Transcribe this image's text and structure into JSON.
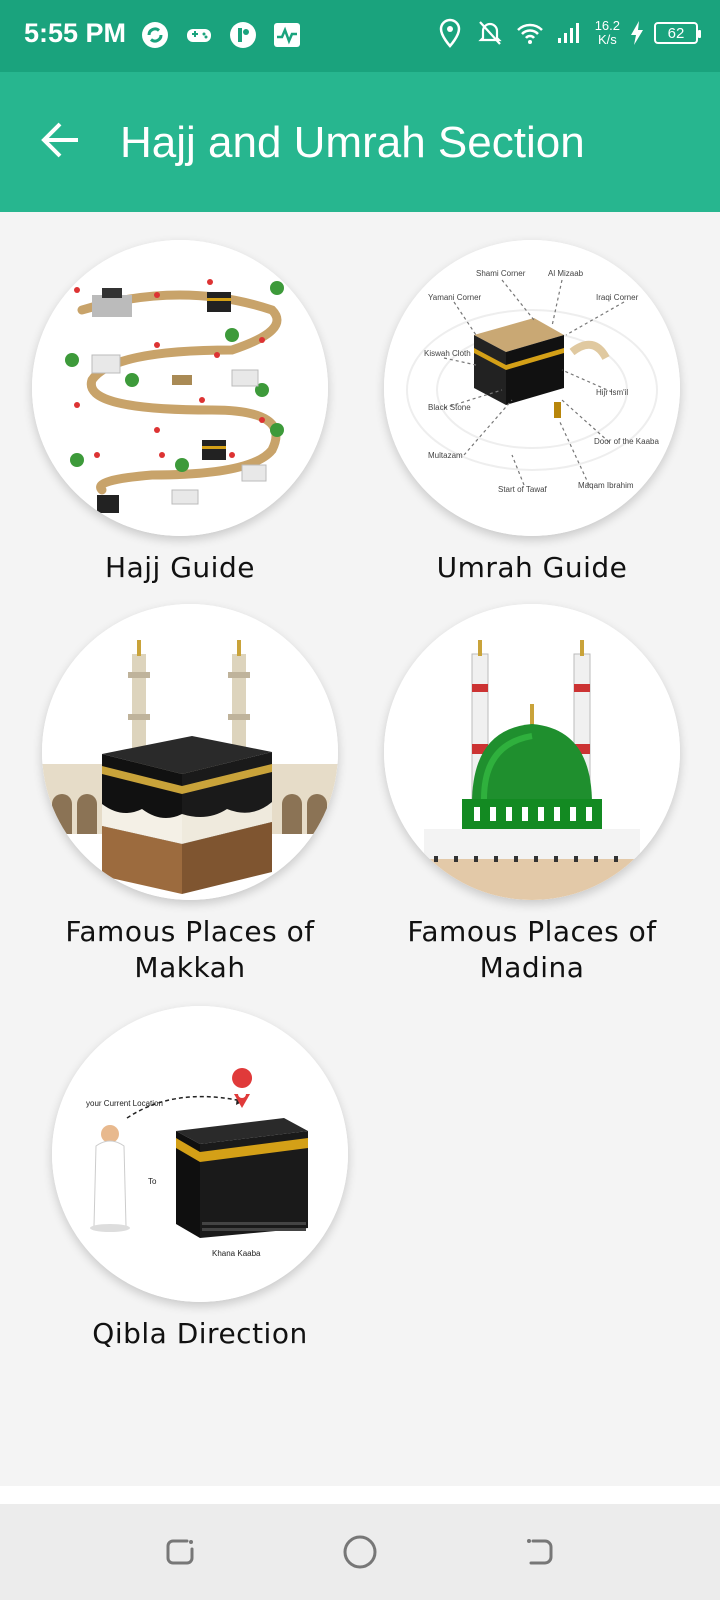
{
  "status_bar": {
    "time": "5:55 PM",
    "speed_value": "16.2",
    "speed_unit": "K/s",
    "battery": "62",
    "icons": [
      "sync-icon",
      "gamepad-icon",
      "app-icon",
      "activity-icon",
      "location-icon",
      "bell-off-icon",
      "wifi-icon",
      "signal-icon",
      "charging-icon"
    ]
  },
  "app_bar": {
    "title": "Hajj and Umrah Section",
    "background": "#27b68f"
  },
  "items": [
    {
      "label": "Hajj Guide",
      "image": "hajj-steps-map"
    },
    {
      "label": "Umrah Guide",
      "image": "kaaba-diagram"
    },
    {
      "label": "Famous Places of Makkah",
      "image": "kaaba-minarets"
    },
    {
      "label": "Famous Places of Madina",
      "image": "green-dome"
    },
    {
      "label": "Qibla Direction",
      "image": "qibla-direction"
    }
  ],
  "umrah_diagram_labels": {
    "shami": "Shami Corner",
    "mizaab": "Al Mizaab",
    "yamani": "Yamani Corner",
    "iraqi": "Iraqi Corner",
    "kiswah": "Kiswah Cloth",
    "hijr": "Hijr Ism'il",
    "black_stone": "Black Stone",
    "door": "Door of the Kaaba",
    "multazam": "Multazam",
    "tawaf": "Start of Tawaf",
    "maqam": "Maqam Ibrahim"
  },
  "qibla_labels": {
    "current": "your Current Location",
    "to": "To",
    "kaaba": "Khana Kaaba"
  },
  "nav": {
    "buttons": [
      "recent-apps-button",
      "home-button",
      "back-nav-button"
    ]
  }
}
